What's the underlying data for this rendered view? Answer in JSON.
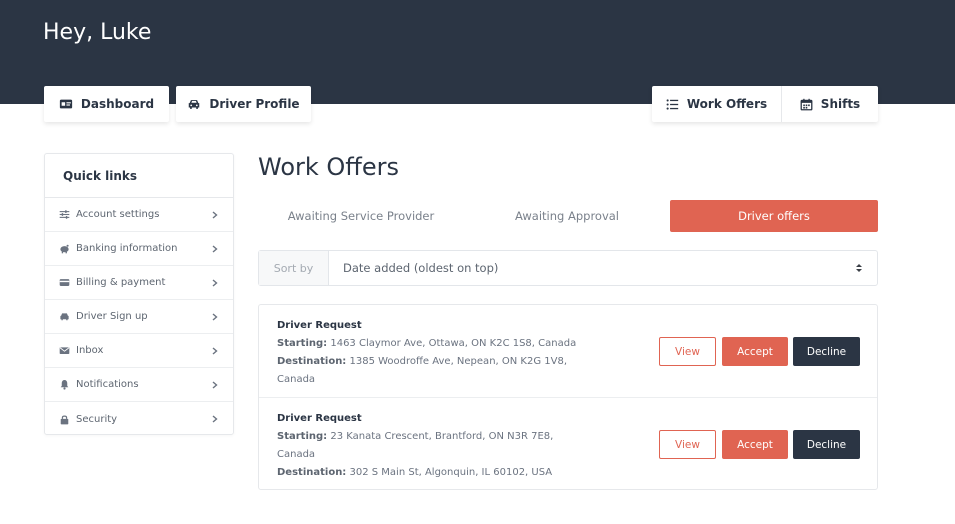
{
  "header": {
    "greeting": "Hey, Luke"
  },
  "nav": {
    "dashboard": {
      "label": "Dashboard",
      "icon": "id-card-icon"
    },
    "driver_profile": {
      "label": "Driver Profile",
      "icon": "car-icon"
    },
    "work_offers": {
      "label": "Work Offers",
      "icon": "list-icon"
    },
    "shifts": {
      "label": "Shifts",
      "icon": "calendar-icon"
    }
  },
  "quick_links": {
    "title": "Quick links",
    "items": [
      {
        "label": "Account settings",
        "icon": "sliders-icon"
      },
      {
        "label": "Banking information",
        "icon": "piggy-bank-icon"
      },
      {
        "label": "Billing & payment",
        "icon": "credit-card-icon"
      },
      {
        "label": "Driver Sign up",
        "icon": "car-icon"
      },
      {
        "label": "Inbox",
        "icon": "envelope-icon"
      },
      {
        "label": "Notifications",
        "icon": "bell-icon"
      },
      {
        "label": "Security",
        "icon": "lock-icon"
      }
    ]
  },
  "main": {
    "title": "Work Offers",
    "tabs": [
      {
        "label": "Awaiting Service Provider",
        "active": false
      },
      {
        "label": "Awaiting Approval",
        "active": false
      },
      {
        "label": "Driver offers",
        "active": true
      }
    ],
    "sort": {
      "label": "Sort by",
      "value": "Date added (oldest on top)"
    },
    "offers": [
      {
        "title": "Driver Request",
        "starting_label": "Starting:",
        "starting": "1463 Claymor Ave, Ottawa, ON K2C 1S8, Canada",
        "destination_label": "Destination:",
        "destination": "1385 Woodroffe Ave, Nepean, ON K2G 1V8, Canada",
        "view": "View",
        "accept": "Accept",
        "decline": "Decline"
      },
      {
        "title": "Driver Request",
        "starting_label": "Starting:",
        "starting": "23 Kanata Crescent, Brantford, ON N3R 7E8, Canada",
        "destination_label": "Destination:",
        "destination": "302 S Main St, Algonquin, IL 60102, USA",
        "view": "View",
        "accept": "Accept",
        "decline": "Decline"
      }
    ]
  },
  "colors": {
    "header_bg": "#2b3544",
    "accent": "#e06452",
    "dark_button": "#2b3544"
  }
}
